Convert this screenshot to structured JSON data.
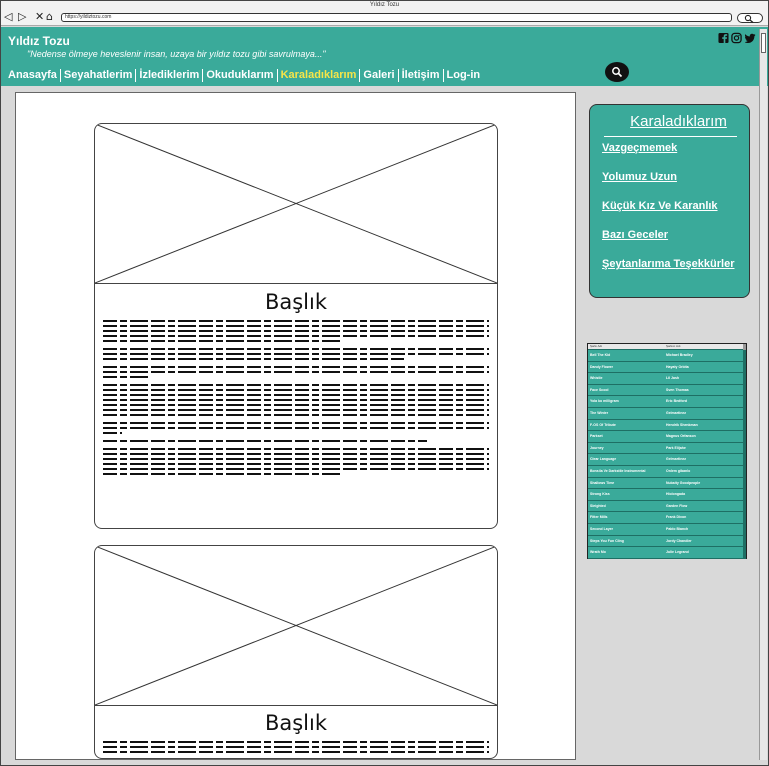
{
  "window": {
    "title": "Yıldız Tozu"
  },
  "browser": {
    "back_glyph": "◁",
    "forward_glyph": "▷",
    "stop_glyph": "✕",
    "home_glyph": "⌂",
    "url": "https://yildiztozu.com"
  },
  "site": {
    "title": "Yıldız Tozu",
    "tagline": "\"Nedense ölmeye heveslenir insan, uzaya bir yıldız tozu gibi savrulmaya...\"",
    "social_icons": [
      "facebook-icon",
      "instagram-icon",
      "twitter-icon"
    ]
  },
  "nav": {
    "items": [
      {
        "label": "Anasayfa",
        "active": false
      },
      {
        "label": "Seyahatlerim",
        "active": false
      },
      {
        "label": "İzlediklerim",
        "active": false
      },
      {
        "label": "Okuduklarım",
        "active": false
      },
      {
        "label": "Karaladıklarım",
        "active": true
      },
      {
        "label": "Galeri",
        "active": false
      },
      {
        "label": "İletişim",
        "active": false
      },
      {
        "label": "Log-in",
        "active": false
      }
    ]
  },
  "posts": [
    {
      "title": "Başlık"
    },
    {
      "title": "Başlık"
    }
  ],
  "sidebar": {
    "title": "Karaladıklarım",
    "links": [
      "Vazgeçmemek",
      "Yolumuz Uzun",
      "Küçük Kız Ve Karanlık",
      "Bazı Geceler",
      "Şeytanlarıma Teşekkürler"
    ]
  },
  "table": {
    "headers": [
      "Şarkı Adı",
      "Şarkıcı Adı"
    ],
    "rows": [
      [
        "Bell The Kid",
        "Michael Bradley"
      ],
      [
        "Dandy Flower",
        "Hayaty Orbita"
      ],
      [
        "Whistle",
        "Lil Jash"
      ],
      [
        "Face Scool",
        "Sven Thomas"
      ],
      [
        "Yola ko milligram",
        "Eric Bedford"
      ],
      [
        "The Winter",
        "Gelmartinez"
      ],
      [
        "F-OS Of Tribute",
        "Hendrik Shenkman"
      ],
      [
        "Parkset",
        "Magnus Orfanson"
      ],
      [
        "Journey",
        "Park Elijahe"
      ],
      [
        "Clear Language",
        "Gelmartinez"
      ],
      [
        "Bonsila Ve Darkstile Instrumental",
        "Onlem gibanlo"
      ],
      [
        "Shallows Time",
        "Nubaity Goodpeople"
      ],
      [
        "Strong Kiss",
        "Hiolongada"
      ],
      [
        "Sleighted",
        "Garden Flow"
      ],
      [
        "Fitter Mills",
        "Frank Dixon"
      ],
      [
        "Second Layer",
        "Pablo Bianch"
      ],
      [
        "Steps You Fun Cling",
        "Jordy Chandler"
      ],
      [
        "Wrath Mo",
        "Julie Legrand"
      ]
    ]
  }
}
